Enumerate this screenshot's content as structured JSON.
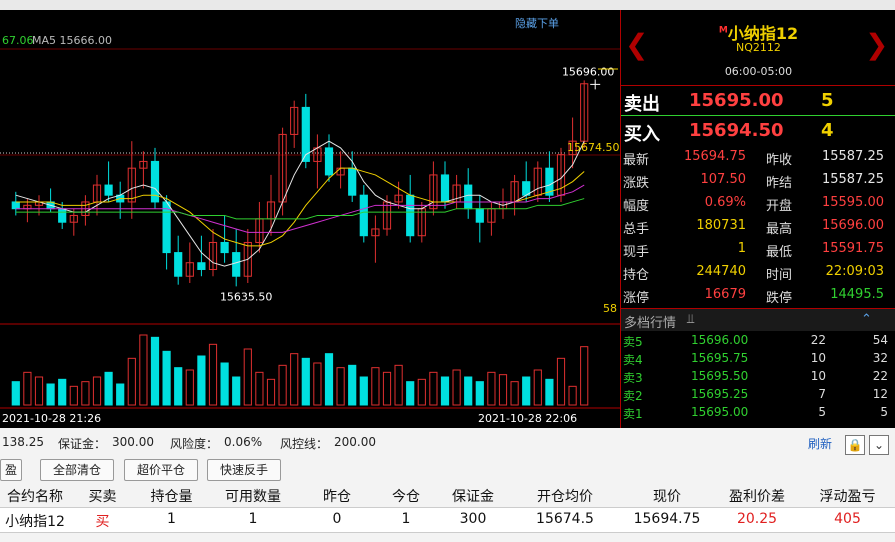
{
  "top_toolbar": {
    "hide_order_label": "隐藏下单"
  },
  "chart": {
    "ma_labels": [
      {
        "text": "67.06",
        "color": "#30d030"
      },
      {
        "text": "MA5 15666.00",
        "color": "#bbbbbb"
      }
    ],
    "high_label": "15696.00",
    "low_label": "15635.50",
    "avg_price_label": "15674.50",
    "last_count_label": "58",
    "x_labels": [
      "2021-10-28 21:26",
      "2021-10-28 22:06"
    ],
    "colors": {
      "up": "#e03030",
      "down": "#00e0e0",
      "ma5": "#e6e6e6",
      "ma10": "#f0d000",
      "ma20": "#d030d0",
      "ma60": "#30d030"
    }
  },
  "chart_data": {
    "type": "candlestick",
    "title": "",
    "y_range": [
      15628,
      15705
    ],
    "candles": [
      {
        "o": 15660,
        "h": 15663,
        "l": 15656,
        "c": 15658
      },
      {
        "o": 15658,
        "h": 15661,
        "l": 15654,
        "c": 15659
      },
      {
        "o": 15659,
        "h": 15662,
        "l": 15656,
        "c": 15660
      },
      {
        "o": 15660,
        "h": 15664,
        "l": 15657,
        "c": 15658
      },
      {
        "o": 15658,
        "h": 15660,
        "l": 15652,
        "c": 15654
      },
      {
        "o": 15654,
        "h": 15658,
        "l": 15650,
        "c": 15656
      },
      {
        "o": 15656,
        "h": 15662,
        "l": 15653,
        "c": 15660
      },
      {
        "o": 15660,
        "h": 15668,
        "l": 15656,
        "c": 15665
      },
      {
        "o": 15665,
        "h": 15672,
        "l": 15660,
        "c": 15662
      },
      {
        "o": 15662,
        "h": 15666,
        "l": 15655,
        "c": 15660
      },
      {
        "o": 15660,
        "h": 15678,
        "l": 15655,
        "c": 15670
      },
      {
        "o": 15670,
        "h": 15675,
        "l": 15664,
        "c": 15672
      },
      {
        "o": 15672,
        "h": 15676,
        "l": 15658,
        "c": 15660
      },
      {
        "o": 15660,
        "h": 15662,
        "l": 15640,
        "c": 15645
      },
      {
        "o": 15645,
        "h": 15650,
        "l": 15635.5,
        "c": 15638
      },
      {
        "o": 15638,
        "h": 15648,
        "l": 15636,
        "c": 15642
      },
      {
        "o": 15642,
        "h": 15650,
        "l": 15638,
        "c": 15640
      },
      {
        "o": 15640,
        "h": 15652,
        "l": 15638,
        "c": 15648
      },
      {
        "o": 15648,
        "h": 15656,
        "l": 15642,
        "c": 15645
      },
      {
        "o": 15645,
        "h": 15652,
        "l": 15635,
        "c": 15638
      },
      {
        "o": 15638,
        "h": 15652,
        "l": 15636,
        "c": 15648
      },
      {
        "o": 15648,
        "h": 15660,
        "l": 15645,
        "c": 15655
      },
      {
        "o": 15655,
        "h": 15668,
        "l": 15650,
        "c": 15660
      },
      {
        "o": 15660,
        "h": 15682,
        "l": 15656,
        "c": 15680
      },
      {
        "o": 15680,
        "h": 15690,
        "l": 15676,
        "c": 15688
      },
      {
        "o": 15688,
        "h": 15692,
        "l": 15670,
        "c": 15672
      },
      {
        "o": 15672,
        "h": 15680,
        "l": 15664,
        "c": 15676
      },
      {
        "o": 15676,
        "h": 15680,
        "l": 15666,
        "c": 15668
      },
      {
        "o": 15668,
        "h": 15675,
        "l": 15664,
        "c": 15670
      },
      {
        "o": 15670,
        "h": 15675,
        "l": 15660,
        "c": 15662
      },
      {
        "o": 15662,
        "h": 15665,
        "l": 15648,
        "c": 15650
      },
      {
        "o": 15650,
        "h": 15656,
        "l": 15642,
        "c": 15652
      },
      {
        "o": 15652,
        "h": 15662,
        "l": 15650,
        "c": 15660
      },
      {
        "o": 15660,
        "h": 15666,
        "l": 15658,
        "c": 15662
      },
      {
        "o": 15662,
        "h": 15668,
        "l": 15648,
        "c": 15650
      },
      {
        "o": 15650,
        "h": 15660,
        "l": 15648,
        "c": 15658
      },
      {
        "o": 15658,
        "h": 15672,
        "l": 15656,
        "c": 15668
      },
      {
        "o": 15668,
        "h": 15672,
        "l": 15658,
        "c": 15660
      },
      {
        "o": 15660,
        "h": 15668,
        "l": 15658,
        "c": 15665
      },
      {
        "o": 15665,
        "h": 15670,
        "l": 15655,
        "c": 15658
      },
      {
        "o": 15658,
        "h": 15662,
        "l": 15648,
        "c": 15654
      },
      {
        "o": 15654,
        "h": 15660,
        "l": 15650,
        "c": 15658
      },
      {
        "o": 15658,
        "h": 15664,
        "l": 15655,
        "c": 15660
      },
      {
        "o": 15660,
        "h": 15668,
        "l": 15656,
        "c": 15666
      },
      {
        "o": 15666,
        "h": 15672,
        "l": 15660,
        "c": 15662
      },
      {
        "o": 15662,
        "h": 15672,
        "l": 15660,
        "c": 15670
      },
      {
        "o": 15670,
        "h": 15675,
        "l": 15660,
        "c": 15662
      },
      {
        "o": 15662,
        "h": 15676,
        "l": 15660,
        "c": 15674
      },
      {
        "o": 15674,
        "h": 15685,
        "l": 15670,
        "c": 15678
      },
      {
        "o": 15678,
        "h": 15696,
        "l": 15676,
        "c": 15695
      }
    ],
    "volumes": [
      10,
      14,
      12,
      9,
      11,
      8,
      10,
      12,
      14,
      9,
      20,
      30,
      29,
      23,
      16,
      15,
      21,
      26,
      18,
      12,
      24,
      14,
      11,
      17,
      22,
      20,
      18,
      22,
      16,
      17,
      12,
      16,
      14,
      17,
      10,
      11,
      14,
      12,
      15,
      12,
      10,
      14,
      13,
      10,
      12,
      15,
      11,
      20,
      8,
      25
    ],
    "ma": {
      "ma5": [
        15662,
        15661,
        15660,
        15659,
        15658,
        15657,
        15657,
        15659,
        15661,
        15662,
        15664,
        15665,
        15664,
        15660,
        15655,
        15650,
        15645,
        15642,
        15641,
        15642,
        15643,
        15646,
        15652,
        15660,
        15668,
        15674,
        15676,
        15678,
        15676,
        15672,
        15666,
        15662,
        15660,
        15659,
        15658,
        15658,
        15660,
        15660,
        15661,
        15662,
        15662,
        15660,
        15659,
        15660,
        15662,
        15664,
        15665,
        15667,
        15671,
        15678
      ],
      "ma10": [
        15660,
        15660,
        15660,
        15660,
        15659,
        15659,
        15659,
        15660,
        15660,
        15661,
        15661,
        15662,
        15662,
        15661,
        15659,
        15657,
        15654,
        15651,
        15649,
        15648,
        15647,
        15647,
        15648,
        15650,
        15654,
        15659,
        15663,
        15667,
        15670,
        15670,
        15669,
        15668,
        15666,
        15664,
        15662,
        15661,
        15660,
        15660,
        15660,
        15660,
        15660,
        15660,
        15660,
        15660,
        15661,
        15662,
        15663,
        15664,
        15666,
        15669
      ],
      "ma20": [
        15658,
        15658,
        15658,
        15658,
        15658,
        15658,
        15658,
        15658,
        15658,
        15658,
        15658,
        15658,
        15658,
        15658,
        15657,
        15656,
        15655,
        15654,
        15653,
        15652,
        15651,
        15651,
        15651,
        15651,
        15652,
        15653,
        15654,
        15655,
        15656,
        15657,
        15658,
        15659,
        15659,
        15659,
        15659,
        15659,
        15659,
        15659,
        15660,
        15660,
        15660,
        15660,
        15660,
        15660,
        15660,
        15661,
        15661,
        15662,
        15663,
        15665
      ],
      "ma60": [
        15657,
        15657,
        15657,
        15657,
        15657,
        15657,
        15657,
        15657,
        15657,
        15657,
        15657,
        15657,
        15657,
        15657,
        15657,
        15656,
        15656,
        15656,
        15656,
        15655,
        15655,
        15655,
        15655,
        15655,
        15655,
        15655,
        15656,
        15656,
        15656,
        15656,
        15657,
        15657,
        15657,
        15657,
        15657,
        15657,
        15657,
        15657,
        15658,
        15658,
        15658,
        15658,
        15658,
        15658,
        15658,
        15659,
        15659,
        15659,
        15660,
        15661
      ]
    }
  },
  "quote": {
    "symbol_name": "小纳指12",
    "symbol_badge": "M",
    "symbol_code": "NQ2112",
    "session": "06:00-05:00",
    "sell_label": "卖出",
    "sell_price": "15695.00",
    "sell_qty": "5",
    "buy_label": "买入",
    "buy_price": "15694.50",
    "buy_qty": "4",
    "stats": [
      {
        "l1": "最新",
        "v1": "15694.75",
        "c1": "#ff4040",
        "l2": "昨收",
        "v2": "15587.25",
        "c2": "#e6e6e6"
      },
      {
        "l1": "涨跌",
        "v1": "107.50",
        "c1": "#ff4040",
        "l2": "昨结",
        "v2": "15587.25",
        "c2": "#e6e6e6"
      },
      {
        "l1": "幅度",
        "v1": "0.69%",
        "c1": "#ff4040",
        "l2": "开盘",
        "v2": "15595.00",
        "c2": "#ff4040"
      },
      {
        "l1": "总手",
        "v1": "180731",
        "c1": "#f0d000",
        "l2": "最高",
        "v2": "15696.00",
        "c2": "#ff4040"
      },
      {
        "l1": "现手",
        "v1": "1",
        "c1": "#f0d000",
        "l2": "最低",
        "v2": "15591.75",
        "c2": "#ff4040"
      },
      {
        "l1": "持仓",
        "v1": "244740",
        "c1": "#f0d000",
        "l2": "时间",
        "v2": "22:09:03",
        "c2": "#f0d000"
      },
      {
        "l1": "涨停",
        "v1": "16679",
        "c1": "#ff4040",
        "l2": "跌停",
        "v2": "14495.5",
        "c2": "#30d030"
      }
    ],
    "depth_title": "多档行情",
    "depth": [
      {
        "label": "卖5",
        "price": "15696.00",
        "qty": "22",
        "total": "54"
      },
      {
        "label": "卖4",
        "price": "15695.75",
        "qty": "10",
        "total": "32"
      },
      {
        "label": "卖3",
        "price": "15695.50",
        "qty": "10",
        "total": "22"
      },
      {
        "label": "卖2",
        "price": "15695.25",
        "qty": "7",
        "total": "12"
      },
      {
        "label": "卖1",
        "price": "15695.00",
        "qty": "5",
        "total": "5"
      }
    ]
  },
  "account": {
    "equity": "138.25",
    "margin_label": "保证金：",
    "margin": "300.00",
    "risk_label": "风险度：",
    "risk": "0.06%",
    "control_label": "风控线：",
    "control": "200.00",
    "refresh_label": "刷新"
  },
  "buttons": {
    "tab_label": "盈",
    "close_all": "全部清仓",
    "over_close": "超价平仓",
    "quick_reverse": "快速反手"
  },
  "positions": {
    "headers": [
      "合约名称",
      "买卖",
      "持仓量",
      "可用数量",
      "昨仓",
      "今仓",
      "保证金",
      "开仓均价",
      "现价",
      "盈利价差",
      "浮动盈亏"
    ],
    "rows": [
      [
        "小纳指12",
        "买",
        "1",
        "1",
        "0",
        "1",
        "300",
        "15674.5",
        "15694.75",
        "20.25",
        "405"
      ]
    ]
  }
}
